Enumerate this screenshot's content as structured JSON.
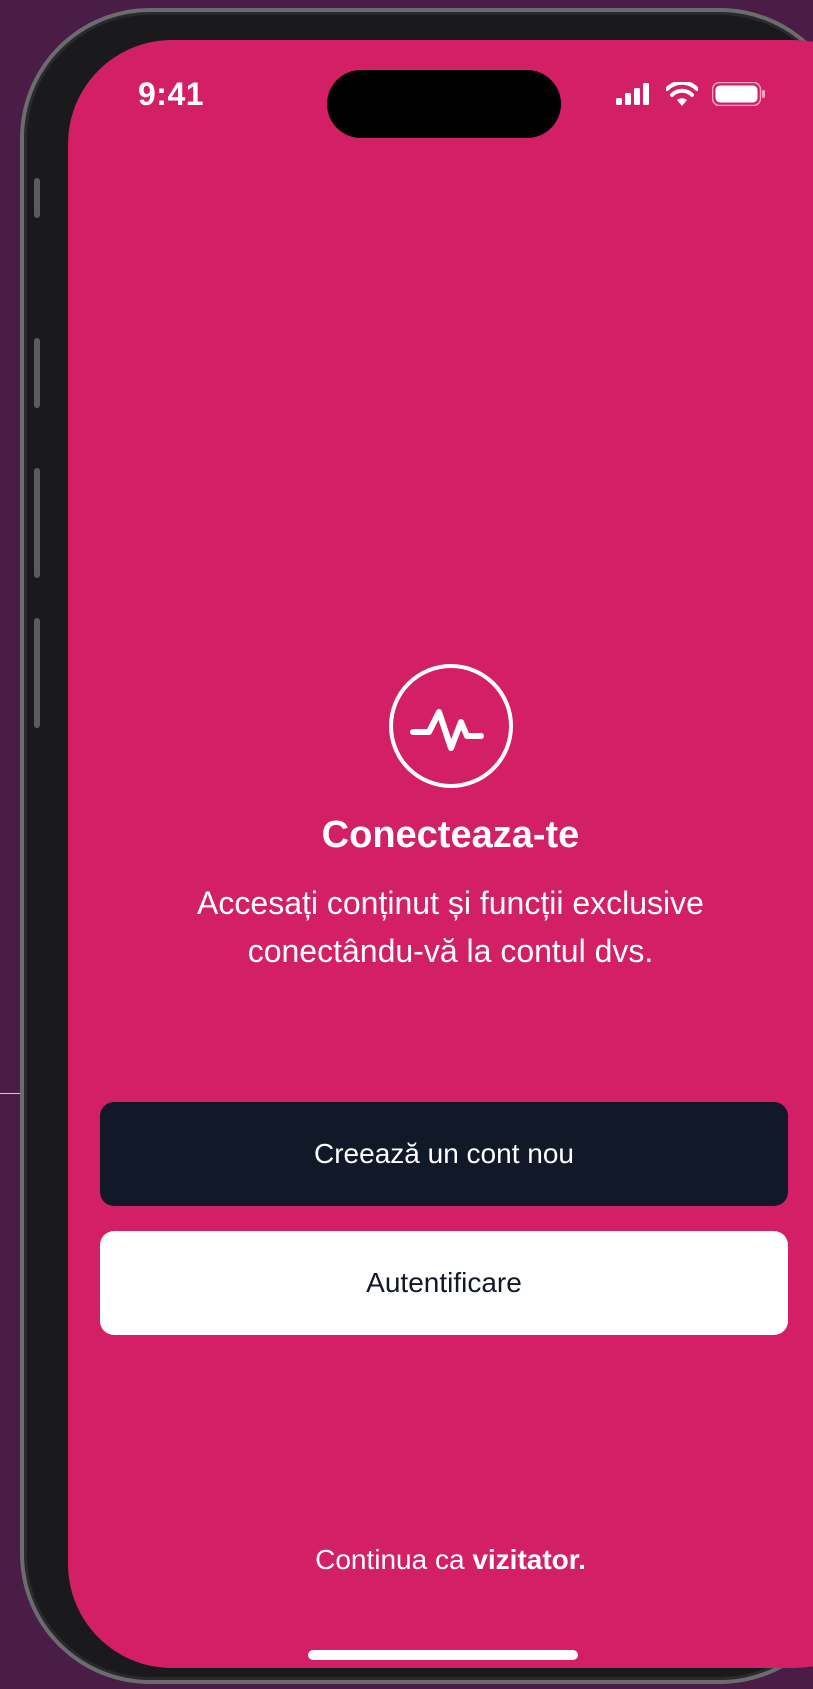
{
  "status_bar": {
    "time": "9:41",
    "icons": [
      "cellular-signal-icon",
      "wifi-icon",
      "battery-icon"
    ]
  },
  "colors": {
    "background": "#4a1d46",
    "screen": "#d31f66",
    "primary_button": "#111827",
    "secondary_button": "#ffffff",
    "text": "#ffffff"
  },
  "hero": {
    "icon": "activity-pulse-icon",
    "title": "Conecteaza-te",
    "subtitle": "Accesați conținut și funcții exclusive conectându-vă la contul dvs."
  },
  "actions": {
    "create_account_label": "Creează un cont nou",
    "login_label": "Autentificare"
  },
  "guest": {
    "prefix": "Continua ca ",
    "link": "vizitator."
  }
}
